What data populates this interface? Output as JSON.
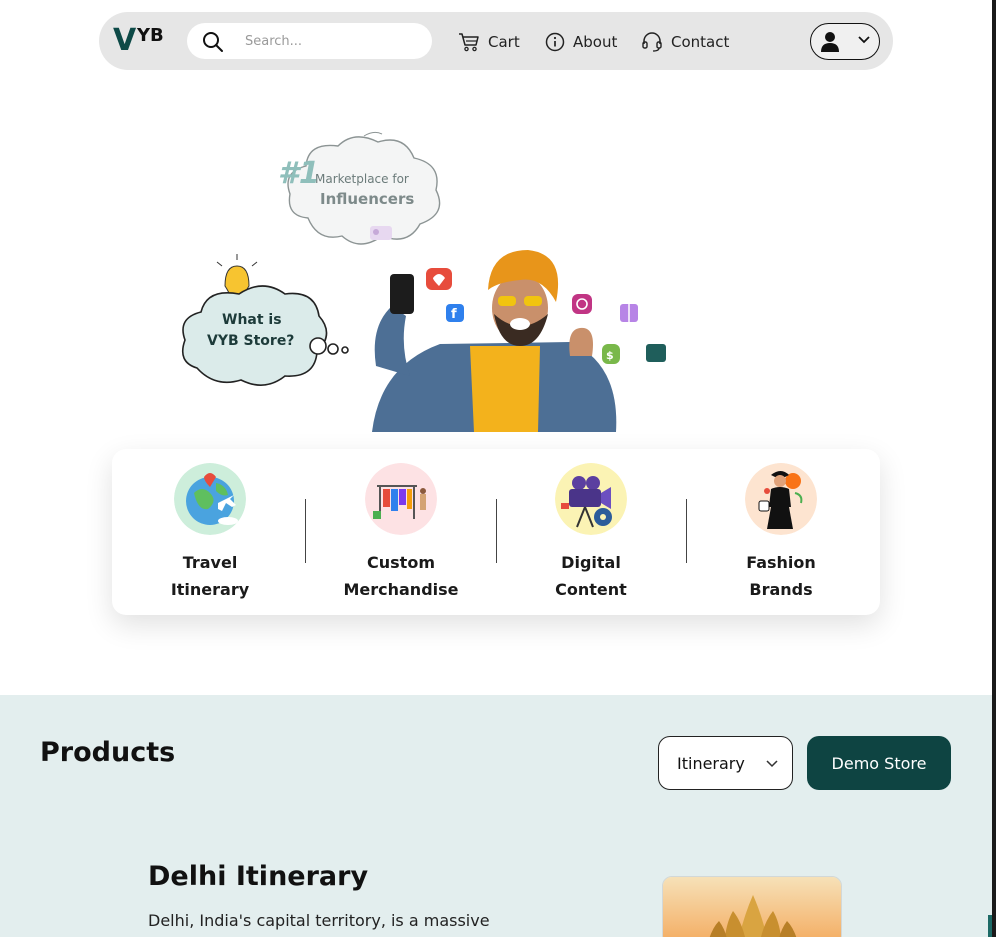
{
  "nav": {
    "logo_v": "V",
    "logo_yb": "YB",
    "search_placeholder": "Search...",
    "cart": "Cart",
    "about": "About",
    "contact": "Contact"
  },
  "hero": {
    "rank": "#1",
    "tagline_1": "Marketplace for",
    "tagline_2": "Influencers",
    "question_1": "What is",
    "question_2": "VYB Store?"
  },
  "categories": [
    {
      "line1": "Travel",
      "line2": "Itinerary"
    },
    {
      "line1": "Custom",
      "line2": "Merchandise"
    },
    {
      "line1": "Digital",
      "line2": "Content"
    },
    {
      "line1": "Fashion",
      "line2": "Brands"
    }
  ],
  "products": {
    "title": "Products",
    "filter_value": "Itinerary",
    "demo_button": "Demo Store",
    "item": {
      "title": "Delhi Itinerary",
      "description": "Delhi, India's capital territory, is a massive"
    }
  },
  "colors": {
    "brand_dark": "#0e4442",
    "products_bg": "#e3eeee",
    "navbar_bg": "#e6e6e6"
  }
}
